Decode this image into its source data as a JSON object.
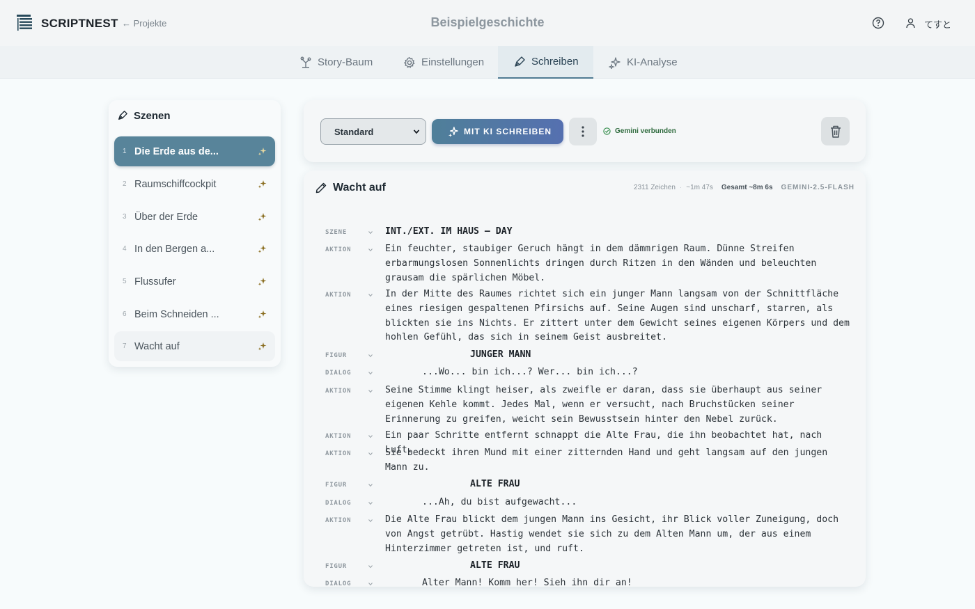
{
  "app": {
    "name": "SCRIPTNEST",
    "back_label": "← Projekte",
    "story_title": "Beispielgeschichte",
    "user_name": "てすと"
  },
  "tabs": [
    {
      "label": "Story-Baum",
      "icon": "tree-icon"
    },
    {
      "label": "Einstellungen",
      "icon": "gear-icon"
    },
    {
      "label": "Schreiben",
      "icon": "pen-icon",
      "active": true
    },
    {
      "label": "KI-Analyse",
      "icon": "sparkles-icon"
    }
  ],
  "sidebar": {
    "title": "Szenen",
    "scenes": [
      {
        "num": "1",
        "label": "Die Erde aus de..."
      },
      {
        "num": "2",
        "label": "Raumschiffcockpit"
      },
      {
        "num": "3",
        "label": "Über der Erde"
      },
      {
        "num": "4",
        "label": "In den Bergen a..."
      },
      {
        "num": "5",
        "label": "Flussufer"
      },
      {
        "num": "6",
        "label": "Beim Schneiden ..."
      },
      {
        "num": "7",
        "label": "Wacht auf"
      }
    ]
  },
  "toolbar": {
    "mode": "Standard",
    "ai_write_label": "MIT KI SCHREIBEN",
    "status": "Gemini verbunden"
  },
  "editor": {
    "title": "Wacht auf",
    "chars": "2311 Zeichen",
    "duration": "~1m 47s",
    "total": "Gesamt ~8m 6s",
    "model": "GEMINI-2.5-FLASH",
    "lines": [
      {
        "type": "SZENE",
        "kind": "heading",
        "text": "INT./EXT. IM HAUS – DAY"
      },
      {
        "type": "AKTION",
        "kind": "action",
        "text": "Ein feuchter, staubiger Geruch hängt in dem dämmrigen Raum. Dünne Streifen erbarmungslosen Sonnenlichts dringen durch Ritzen in den Wänden und beleuchten grausam die spärlichen Möbel."
      },
      {
        "type": "AKTION",
        "kind": "action",
        "text": "In der Mitte des Raumes richtet sich ein junger Mann langsam von der Schnittfläche eines riesigen gespaltenen Pfirsichs auf. Seine Augen sind unscharf, starren, als blickten sie ins Nichts. Er zittert unter dem Gewicht seines eigenen Körpers und dem hohlen Gefühl, das sich in seinem Geist ausbreitet."
      },
      {
        "type": "FIGUR",
        "kind": "figure",
        "text": "JUNGER MANN"
      },
      {
        "type": "DIALOG",
        "kind": "dialog",
        "text": "...Wo... bin ich...? Wer... bin ich...?"
      },
      {
        "type": "AKTION",
        "kind": "action",
        "text": "Seine Stimme klingt heiser, als zweifle er daran, dass sie überhaupt aus seiner eigenen Kehle kommt. Jedes Mal, wenn er versucht, nach Bruchstücken seiner Erinnerung zu greifen, weicht sein Bewusstsein hinter den Nebel zurück."
      },
      {
        "type": "AKTION",
        "kind": "action",
        "text": "Ein paar Schritte entfernt schnappt die Alte Frau, die ihn beobachtet hat, nach Luft."
      },
      {
        "type": "AKTION",
        "kind": "action",
        "text": "Sie bedeckt ihren Mund mit einer zitternden Hand und geht langsam auf den jungen Mann zu."
      },
      {
        "type": "FIGUR",
        "kind": "figure",
        "text": "ALTE FRAU"
      },
      {
        "type": "DIALOG",
        "kind": "dialog",
        "text": "...Ah, du bist aufgewacht..."
      },
      {
        "type": "AKTION",
        "kind": "action",
        "text": "Die Alte Frau blickt dem jungen Mann ins Gesicht, ihr Blick voller Zuneigung, doch von Angst getrübt. Hastig wendet sie sich zu dem Alten Mann um, der aus einem Hinterzimmer getreten ist, und ruft."
      },
      {
        "type": "FIGUR",
        "kind": "figure",
        "text": "ALTE FRAU"
      },
      {
        "type": "DIALOG",
        "kind": "dialog",
        "text": "Alter Mann! Komm her! Sieh ihn dir an!"
      }
    ]
  },
  "colors": {
    "accent": "#58849a",
    "status_ok": "#2f6b3e"
  }
}
